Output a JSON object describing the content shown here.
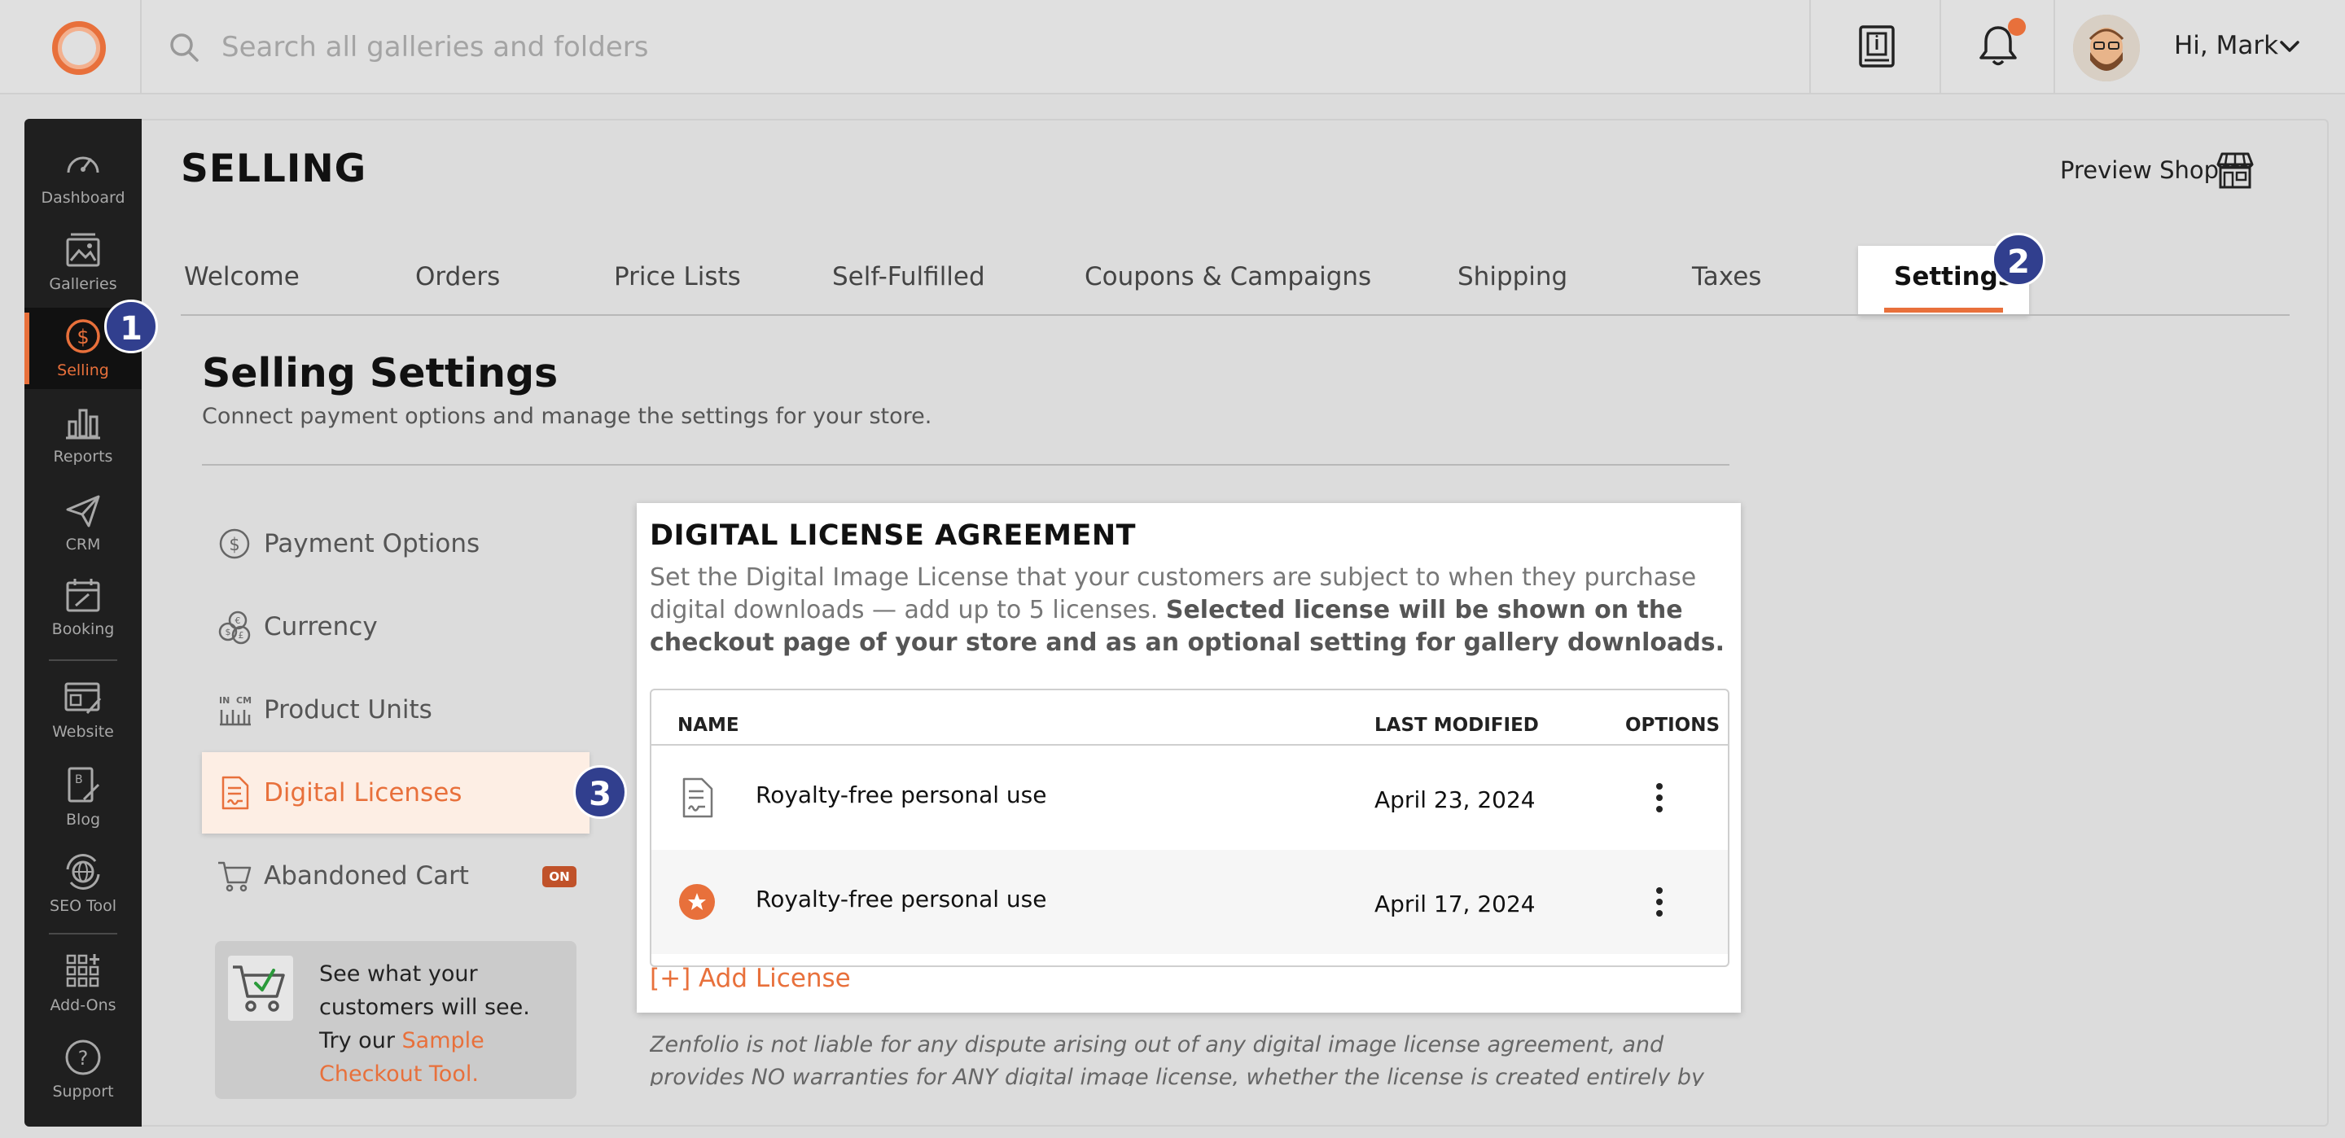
{
  "topbar": {
    "search_placeholder": "Search all galleries and folders",
    "greeting": "Hi, Mark"
  },
  "nav": {
    "items": [
      {
        "label": "Dashboard"
      },
      {
        "label": "Galleries"
      },
      {
        "label": "Selling"
      },
      {
        "label": "Reports"
      },
      {
        "label": "CRM"
      },
      {
        "label": "Booking"
      },
      {
        "label": "Website"
      },
      {
        "label": "Blog"
      },
      {
        "label": "SEO Tool"
      },
      {
        "label": "Add-Ons"
      },
      {
        "label": "Support"
      }
    ],
    "active": "Selling"
  },
  "header": {
    "title": "SELLING",
    "preview_shop": "Preview Shop"
  },
  "tabs": [
    "Welcome",
    "Orders",
    "Price Lists",
    "Self-Fulfilled",
    "Coupons & Campaigns",
    "Shipping",
    "Taxes",
    "Settings"
  ],
  "active_tab": "Settings",
  "section": {
    "title": "Selling Settings",
    "subtitle": "Connect payment options and manage the settings for your store."
  },
  "side_menu": [
    {
      "label": "Payment Options"
    },
    {
      "label": "Currency"
    },
    {
      "label": "Product Units"
    },
    {
      "label": "Digital Licenses"
    },
    {
      "label": "Abandoned Cart",
      "badge": "ON"
    }
  ],
  "promo": {
    "text": "See what your customers will see. Try our ",
    "link": "Sample Checkout Tool."
  },
  "card": {
    "title": "DIGITAL LICENSE AGREEMENT",
    "desc_plain": "Set the Digital Image License that your customers are subject to when they purchase digital downloads — add up to 5 licenses. ",
    "desc_bold": "Selected license will be shown on the checkout page of your store and as an optional setting for gallery downloads.",
    "columns": {
      "name": "NAME",
      "modified": "LAST MODIFIED",
      "options": "OPTIONS"
    },
    "rows": [
      {
        "name": "Royalty-free personal use",
        "modified": "April 23, 2024",
        "icon": "document-icon"
      },
      {
        "name": "Royalty-free personal use",
        "modified": "April 17, 2024",
        "icon": "star-icon"
      }
    ],
    "add_label": "[+] Add License"
  },
  "disclaimer": "Zenfolio is not liable for any dispute arising out of any digital image license agreement, and provides NO warranties for ANY digital image license, whether the license is created entirely by you, the Photographer.",
  "callouts": [
    "1",
    "2",
    "3"
  ],
  "colors": {
    "accent": "#e8703b",
    "nav_bg": "#1f1f1f",
    "callout": "#313f8e"
  }
}
